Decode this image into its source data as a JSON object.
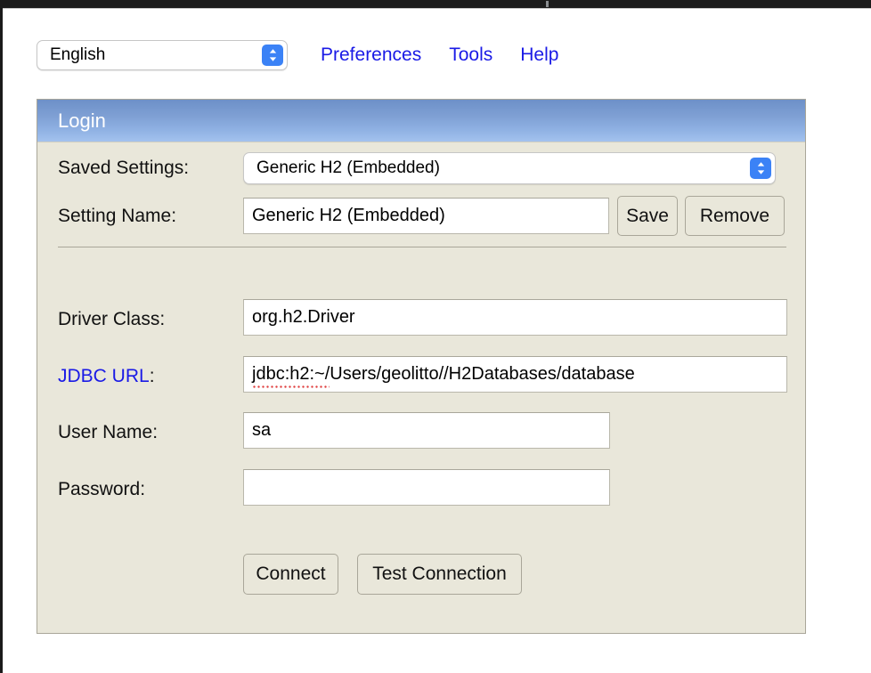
{
  "toolbar": {
    "language_select": {
      "value": "English",
      "options": [
        "English"
      ],
      "stepper_icon": "chevron-up-down-icon"
    },
    "links": [
      {
        "label": "Preferences"
      },
      {
        "label": "Tools"
      },
      {
        "label": "Help"
      }
    ]
  },
  "panel": {
    "title": "Login",
    "header_gradient_top": "#6d90c8",
    "header_gradient_bottom": "#a3c2ee",
    "background": "#e9e7da",
    "border_color": "#a9a699"
  },
  "form": {
    "saved_settings": {
      "label": "Saved Settings:",
      "value": "Generic H2 (Embedded)",
      "options": [
        "Generic H2 (Embedded)"
      ],
      "stepper_icon": "chevron-up-down-icon"
    },
    "setting_name": {
      "label": "Setting Name:",
      "value": "Generic H2 (Embedded)",
      "placeholder": ""
    },
    "save_button": {
      "label": "Save"
    },
    "remove_button": {
      "label": "Remove"
    },
    "driver_class": {
      "label": "Driver Class:",
      "value": "org.h2.Driver",
      "placeholder": ""
    },
    "jdbc_url": {
      "label": "JDBC URL",
      "label_colon": ":",
      "label_color": "#1a1ae6",
      "value_misspelled": "jdbc:h2:~/",
      "value_rest": "Users/geolitto//H2Databases/database",
      "value_full": "jdbc:h2:~/Users/geolitto//H2Databases/database",
      "placeholder": "",
      "spellcheck_underline_color": "#e04040"
    },
    "user_name": {
      "label": "User Name:",
      "value": "sa",
      "placeholder": ""
    },
    "password": {
      "label": "Password:",
      "value": "",
      "placeholder": ""
    },
    "connect_button": {
      "label": "Connect"
    },
    "test_connection_button": {
      "label": "Test Connection"
    }
  }
}
